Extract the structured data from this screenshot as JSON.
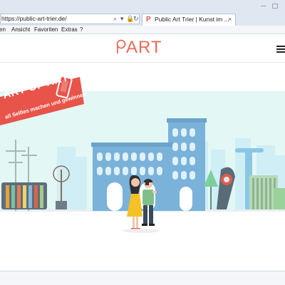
{
  "browser": {
    "url": "https://public-art-trier.de/",
    "active_tab_title": "Public Art Trier | Kunst im ...",
    "menu": [
      "en",
      "Ansicht",
      "Favoriten",
      "Extras",
      "?"
    ]
  },
  "site": {
    "logo_text": "ART",
    "banner_title": "ART OF ART",
    "banner_subtitle": "all Selfies machen und gewinnen!"
  },
  "icons": {
    "search": "search-icon",
    "lock": "lock-icon",
    "reload": "reload-icon",
    "menu": "hamburger-menu-icon",
    "phone": "smartphone-icon"
  },
  "colors": {
    "brand_red": "#e8544a",
    "logo": "#ea6b59",
    "sky": "#e3f7f4",
    "gate_blue": "#7ab2d9",
    "chrome": "#dfe7f1"
  }
}
